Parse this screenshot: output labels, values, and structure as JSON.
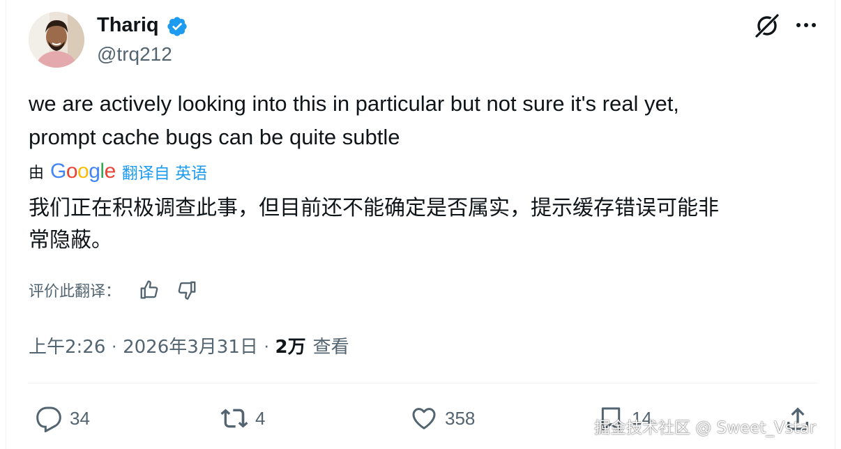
{
  "author": {
    "name": "Thariq",
    "handle": "@trq212",
    "verified": true
  },
  "tweet": {
    "lines": [
      "we are actively looking into this in particular but not sure it's real yet,",
      "prompt cache bugs can be quite subtle"
    ]
  },
  "translation": {
    "by_label": "由",
    "provider": "Google",
    "link_label": "翻译自 英语",
    "lines": [
      "我们正在积极调查此事，但目前还不能确定是否属实，提示缓存错误可能非",
      "常隐蔽。"
    ],
    "rate_label": "评价此翻译："
  },
  "meta": {
    "time": "上午2:26",
    "date": "2026年3月31日",
    "separator": "·",
    "views_count": "2万",
    "views_label": "查看"
  },
  "actions": {
    "reply": "34",
    "retweet": "4",
    "like": "358",
    "bookmark": "14"
  },
  "watermark": "掘金技术社区 @ Sweet_Vstar",
  "colors": {
    "text": "#0f1419",
    "secondary": "#536471",
    "accent": "#1d9bf0",
    "divider": "#eff3f4"
  },
  "icons": [
    "verified-badge-icon",
    "grok-icon",
    "more-icon",
    "thumbs-up-icon",
    "thumbs-down-icon",
    "reply-icon",
    "retweet-icon",
    "like-icon",
    "bookmark-icon",
    "share-icon"
  ]
}
